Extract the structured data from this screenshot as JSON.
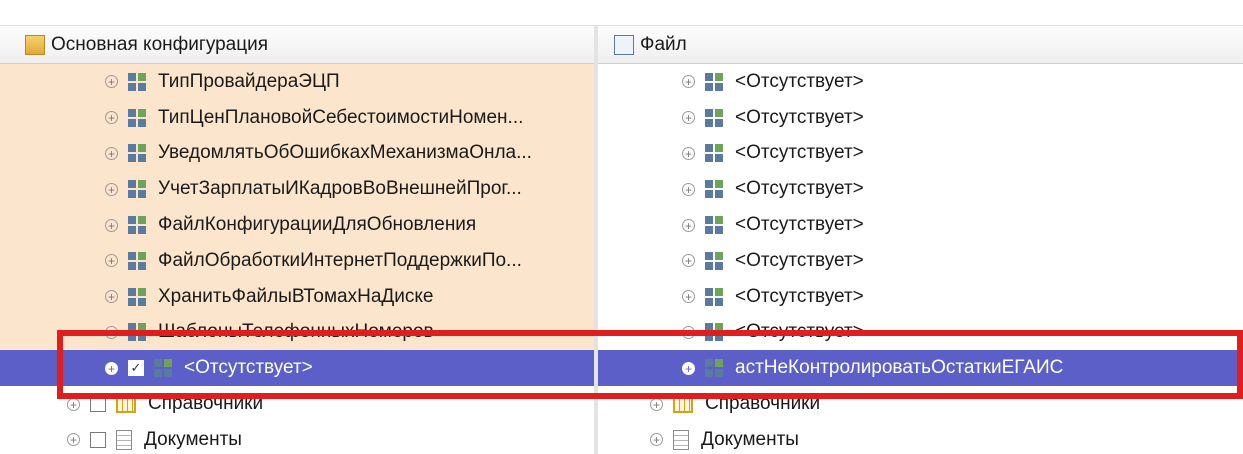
{
  "left": {
    "header": "Основная конфигурация",
    "rows": [
      {
        "label": "ТипПровайдераЭЦП"
      },
      {
        "label": "ТипЦенПлановойСебестоимостиНомен..."
      },
      {
        "label": "УведомлятьОбОшибкахМеханизмаОнла..."
      },
      {
        "label": "УчетЗарплатыИКадровВоВнешнейПрог..."
      },
      {
        "label": "ФайлКонфигурацииДляОбновления"
      },
      {
        "label": "ФайлОбработкиИнтернетПоддержкиПо..."
      },
      {
        "label": "ХранитьФайлыВТомахНаДиске"
      },
      {
        "label": "ШаблоныТелефонныхНомеров"
      },
      {
        "label": "<Отсутствует>"
      },
      {
        "label": "Справочники"
      },
      {
        "label": "Документы"
      }
    ]
  },
  "right": {
    "header": "Файл",
    "rows": [
      {
        "label": "<Отсутствует>"
      },
      {
        "label": "<Отсутствует>"
      },
      {
        "label": "<Отсутствует>"
      },
      {
        "label": "<Отсутствует>"
      },
      {
        "label": "<Отсутствует>"
      },
      {
        "label": "<Отсутствует>"
      },
      {
        "label": "<Отсутствует>"
      },
      {
        "label": "<Отсутствует>"
      },
      {
        "label": "астНеКонтролироватьОстаткиЕГАИС"
      },
      {
        "label": "Справочники"
      },
      {
        "label": "Документы"
      }
    ]
  },
  "selected_checkbox": "✓",
  "colors": {
    "selection": "#5b5fc7",
    "left_bg": "#fce5cd",
    "highlight_box": "#e01e1e"
  },
  "icons": {
    "expand": "plus-circle-icon",
    "constant": "constant-icon",
    "catalog": "catalog-icon",
    "document": "document-icon"
  }
}
